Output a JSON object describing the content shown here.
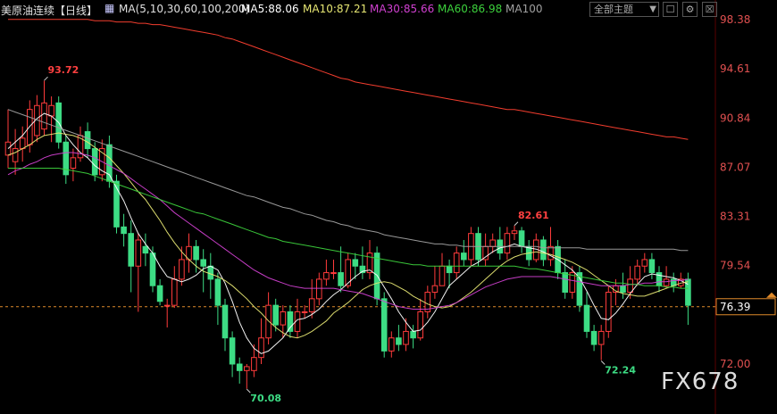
{
  "header": {
    "instrument": "美原油连续【日线】",
    "ma_params": "MA(5,10,30,60,100,200)",
    "ma5": "MA5:88.06",
    "ma10": "MA10:87.21",
    "ma30": "MA30:85.66",
    "ma60": "MA60:86.98",
    "ma100": "MA100"
  },
  "controls": {
    "theme_select": "全部主题",
    "theme_arrow": "▼",
    "btn_window": "☐",
    "btn_settings": "⚙",
    "btn_close": "☒"
  },
  "watermark": "FX678",
  "colors": {
    "up": "#ff3b3b",
    "down": "#3ddc84",
    "ma5": "#ffffff",
    "ma10": "#e6e673",
    "ma30": "#d040d0",
    "ma60": "#3cd03c",
    "ma100": "#a0a0a0",
    "ma200": "#ff4030"
  },
  "chart_data": {
    "type": "candlestick",
    "ylim": [
      72.0,
      98.38
    ],
    "y_ticks": [
      "98.38",
      "94.61",
      "90.84",
      "87.07",
      "83.31",
      "79.54",
      "76.39",
      "72.00"
    ],
    "last_price": 76.39,
    "annotations": [
      {
        "label": "93.72",
        "value": 93.72,
        "index": 5
      },
      {
        "label": "82.61",
        "value": 82.61,
        "index": 70
      },
      {
        "label": "70.08",
        "value": 70.08,
        "index": 33
      },
      {
        "label": "72.24",
        "value": 72.24,
        "index": 82
      }
    ],
    "candles": [
      [
        88.0,
        89.0,
        91.5,
        87.0
      ],
      [
        87.5,
        88.5,
        90.0,
        86.5
      ],
      [
        88.5,
        89.3,
        90.2,
        87.5
      ],
      [
        88.8,
        91.5,
        92.2,
        88.2
      ],
      [
        89.5,
        91.8,
        92.6,
        89.0
      ],
      [
        90.0,
        92.0,
        93.7,
        89.5
      ],
      [
        91.0,
        91.8,
        92.5,
        89.0
      ],
      [
        92.0,
        89.0,
        92.5,
        88.5
      ],
      [
        89.0,
        86.5,
        89.5,
        85.8
      ],
      [
        87.0,
        87.8,
        88.5,
        86.0
      ],
      [
        87.8,
        89.5,
        90.2,
        87.5
      ],
      [
        89.8,
        88.5,
        90.5,
        87.8
      ],
      [
        88.5,
        86.5,
        89.0,
        86.0
      ],
      [
        86.5,
        88.5,
        89.2,
        86.0
      ],
      [
        88.8,
        86.0,
        89.5,
        85.5
      ],
      [
        86.0,
        82.5,
        86.5,
        82.0
      ],
      [
        82.5,
        82.0,
        83.5,
        81.0
      ],
      [
        82.0,
        79.5,
        83.0,
        77.5
      ],
      [
        79.5,
        81.5,
        82.0,
        76.0
      ],
      [
        81.0,
        80.5,
        82.0,
        79.5
      ],
      [
        80.5,
        78.0,
        81.0,
        77.5
      ],
      [
        78.0,
        76.8,
        78.5,
        76.5
      ],
      [
        76.5,
        76.5,
        77.0,
        74.8
      ],
      [
        76.5,
        78.5,
        79.5,
        76.3
      ],
      [
        78.5,
        80.0,
        81.0,
        78.0
      ],
      [
        80.0,
        81.0,
        82.0,
        79.0
      ],
      [
        81.0,
        80.0,
        81.5,
        79.0
      ],
      [
        80.0,
        79.5,
        80.8,
        77.5
      ],
      [
        79.5,
        78.5,
        80.5,
        77.0
      ],
      [
        78.5,
        76.5,
        79.0,
        75.0
      ],
      [
        76.5,
        74.0,
        77.0,
        73.0
      ],
      [
        74.0,
        72.0,
        74.5,
        71.0
      ],
      [
        72.0,
        71.5,
        72.5,
        70.5
      ],
      [
        71.5,
        71.8,
        72.0,
        70.1
      ],
      [
        71.5,
        72.5,
        73.5,
        71.0
      ],
      [
        72.5,
        74.0,
        75.5,
        72.0
      ],
      [
        74.0,
        76.5,
        77.5,
        73.5
      ],
      [
        76.5,
        75.0,
        77.0,
        74.5
      ],
      [
        75.0,
        76.0,
        76.5,
        74.0
      ],
      [
        76.0,
        74.5,
        76.5,
        74.0
      ],
      [
        74.5,
        76.0,
        77.0,
        74.0
      ],
      [
        76.0,
        76.0,
        76.5,
        75.5
      ],
      [
        76.0,
        77.0,
        78.5,
        75.5
      ],
      [
        77.0,
        78.5,
        79.0,
        76.5
      ],
      [
        78.5,
        79.0,
        80.0,
        78.0
      ],
      [
        79.0,
        79.0,
        80.0,
        78.5
      ],
      [
        79.0,
        78.0,
        81.0,
        77.5
      ],
      [
        78.0,
        80.0,
        80.5,
        77.8
      ],
      [
        80.0,
        79.5,
        80.5,
        78.5
      ],
      [
        79.5,
        79.0,
        81.0,
        78.5
      ],
      [
        79.0,
        80.5,
        81.5,
        78.5
      ],
      [
        80.5,
        77.0,
        81.0,
        76.5
      ],
      [
        77.0,
        73.0,
        77.5,
        72.5
      ],
      [
        73.0,
        74.0,
        74.5,
        72.5
      ],
      [
        74.0,
        73.5,
        75.0,
        73.0
      ],
      [
        73.5,
        74.5,
        75.5,
        73.0
      ],
      [
        74.5,
        74.0,
        75.0,
        73.2
      ],
      [
        74.0,
        76.0,
        77.0,
        73.8
      ],
      [
        76.0,
        77.5,
        78.0,
        75.5
      ],
      [
        77.5,
        78.0,
        79.5,
        77.0
      ],
      [
        78.0,
        79.5,
        80.5,
        78.0
      ],
      [
        79.5,
        79.0,
        80.0,
        77.8
      ],
      [
        79.0,
        80.5,
        81.0,
        78.5
      ],
      [
        80.5,
        80.0,
        81.5,
        79.5
      ],
      [
        80.0,
        82.0,
        82.5,
        79.5
      ],
      [
        82.0,
        80.0,
        82.5,
        79.5
      ],
      [
        80.0,
        81.0,
        82.0,
        79.5
      ],
      [
        81.0,
        81.5,
        82.0,
        80.5
      ],
      [
        81.5,
        80.5,
        82.5,
        80.0
      ],
      [
        80.5,
        82.0,
        82.5,
        80.0
      ],
      [
        82.0,
        82.2,
        82.6,
        81.5
      ],
      [
        82.2,
        81.0,
        82.5,
        80.5
      ],
      [
        81.0,
        80.0,
        81.5,
        79.5
      ],
      [
        80.0,
        81.5,
        82.0,
        79.8
      ],
      [
        81.5,
        80.0,
        81.8,
        79.5
      ],
      [
        80.0,
        81.0,
        82.5,
        79.5
      ],
      [
        81.0,
        79.0,
        81.5,
        78.5
      ],
      [
        79.0,
        77.5,
        80.0,
        77.0
      ],
      [
        77.5,
        79.0,
        79.5,
        77.0
      ],
      [
        79.0,
        76.5,
        79.5,
        76.0
      ],
      [
        76.5,
        74.5,
        77.5,
        74.0
      ],
      [
        74.5,
        73.5,
        75.0,
        73.0
      ],
      [
        73.5,
        74.5,
        75.0,
        72.3
      ],
      [
        74.5,
        77.5,
        78.0,
        74.0
      ],
      [
        77.5,
        78.0,
        78.5,
        76.5
      ],
      [
        78.0,
        77.5,
        79.0,
        77.0
      ],
      [
        77.5,
        78.5,
        79.5,
        77.0
      ],
      [
        78.5,
        79.5,
        80.0,
        78.0
      ],
      [
        79.5,
        80.0,
        80.5,
        79.0
      ],
      [
        80.0,
        79.0,
        80.5,
        78.5
      ],
      [
        79.0,
        78.0,
        79.5,
        77.5
      ],
      [
        78.0,
        78.5,
        79.5,
        77.8
      ],
      [
        78.5,
        78.0,
        79.0,
        77.5
      ],
      [
        78.0,
        78.5,
        79.0,
        77.8
      ],
      [
        78.5,
        76.5,
        79.0,
        75.0
      ]
    ],
    "series": [
      {
        "name": "MA5",
        "values": [
          88.5,
          89.0,
          89.5,
          90.2,
          90.8,
          91.2,
          91.0,
          90.5,
          89.5,
          88.8,
          88.2,
          87.8,
          87.2,
          86.8,
          86.5,
          85.5,
          84.5,
          83.2,
          82.0,
          81.2,
          80.5,
          79.5,
          78.7,
          78.5,
          78.3,
          78.5,
          78.8,
          79.3,
          79.5,
          79.2,
          78.2,
          76.8,
          75.2,
          74.0,
          73.2,
          72.8,
          73.0,
          73.5,
          74.0,
          74.8,
          75.4,
          75.5,
          75.8,
          76.2,
          76.8,
          77.3,
          77.7,
          78.2,
          78.7,
          79.1,
          79.2,
          78.8,
          77.9,
          77.0,
          76.0,
          75.2,
          74.5,
          74.6,
          75.2,
          76.0,
          77.0,
          78.0,
          78.5,
          79.0,
          79.5,
          79.8,
          80.2,
          80.6,
          80.9,
          81.0,
          81.2,
          81.0,
          80.9,
          80.8,
          80.6,
          80.3,
          80.0,
          79.6,
          79.2,
          78.6,
          77.6,
          76.5,
          75.5,
          75.4,
          75.9,
          76.6,
          77.4,
          78.1,
          78.7,
          78.9,
          78.8,
          78.7,
          78.6,
          78.4,
          78.1
        ]
      },
      {
        "name": "MA10",
        "values": [
          88.0,
          88.2,
          88.5,
          88.8,
          89.2,
          89.5,
          89.6,
          89.7,
          89.6,
          89.5,
          89.3,
          89.0,
          88.6,
          88.2,
          87.8,
          87.2,
          86.6,
          85.9,
          85.2,
          84.6,
          83.8,
          83.0,
          82.1,
          81.3,
          80.6,
          80.0,
          79.5,
          79.1,
          78.9,
          78.7,
          78.4,
          78.0,
          77.5,
          77.0,
          76.4,
          75.9,
          75.3,
          74.8,
          74.4,
          74.1,
          74.0,
          74.2,
          74.5,
          74.9,
          75.3,
          75.9,
          76.3,
          76.7,
          77.2,
          77.7,
          78.0,
          78.2,
          78.3,
          78.2,
          77.9,
          77.6,
          77.2,
          76.9,
          76.6,
          76.4,
          76.3,
          76.4,
          76.7,
          77.1,
          77.5,
          78.0,
          78.5,
          79.0,
          79.5,
          79.9,
          80.2,
          80.4,
          80.5,
          80.6,
          80.5,
          80.4,
          80.2,
          80.0,
          79.8,
          79.5,
          79.2,
          78.8,
          78.4,
          78.0,
          77.6,
          77.4,
          77.3,
          77.2,
          77.2,
          77.4,
          77.6,
          77.8,
          78.0,
          78.2,
          78.3
        ]
      },
      {
        "name": "MA30",
        "values": [
          86.5,
          86.8,
          87.0,
          87.3,
          87.5,
          87.8,
          88.0,
          88.1,
          88.2,
          88.2,
          88.1,
          88.0,
          87.8,
          87.5,
          87.2,
          86.9,
          86.6,
          86.2,
          85.8,
          85.4,
          85.0,
          84.6,
          84.1,
          83.6,
          83.2,
          82.8,
          82.4,
          82.0,
          81.6,
          81.2,
          80.8,
          80.4,
          80.0,
          79.6,
          79.2,
          78.9,
          78.6,
          78.4,
          78.2,
          78.0,
          77.9,
          77.8,
          77.8,
          77.8,
          77.8,
          77.8,
          77.7,
          77.6,
          77.5,
          77.4,
          77.2,
          77.0,
          76.8,
          76.6,
          76.4,
          76.3,
          76.2,
          76.2,
          76.2,
          76.3,
          76.4,
          76.5,
          76.7,
          77.0,
          77.3,
          77.6,
          77.9,
          78.1,
          78.3,
          78.5,
          78.6,
          78.7,
          78.7,
          78.7,
          78.7,
          78.7,
          78.6,
          78.5,
          78.4,
          78.3,
          78.2,
          78.1,
          78.0,
          78.0,
          78.0,
          78.0,
          78.1,
          78.1,
          78.2,
          78.2,
          78.3,
          78.3,
          78.4,
          78.4,
          78.5
        ]
      },
      {
        "name": "MA60",
        "values": [
          87.0,
          87.0,
          87.0,
          87.0,
          87.0,
          87.0,
          87.0,
          87.0,
          86.9,
          86.8,
          86.7,
          86.6,
          86.4,
          86.2,
          86.0,
          85.8,
          85.6,
          85.4,
          85.2,
          85.0,
          84.8,
          84.6,
          84.4,
          84.2,
          84.0,
          83.8,
          83.6,
          83.5,
          83.3,
          83.1,
          82.9,
          82.7,
          82.5,
          82.3,
          82.1,
          81.9,
          81.7,
          81.6,
          81.4,
          81.3,
          81.2,
          81.1,
          81.0,
          80.9,
          80.8,
          80.7,
          80.6,
          80.5,
          80.4,
          80.3,
          80.2,
          80.1,
          80.0,
          79.9,
          79.8,
          79.7,
          79.6,
          79.6,
          79.5,
          79.5,
          79.5,
          79.5,
          79.5,
          79.5,
          79.5,
          79.5,
          79.5,
          79.5,
          79.5,
          79.5,
          79.5,
          79.4,
          79.3,
          79.3,
          79.2,
          79.1,
          79.0,
          78.9,
          78.8,
          78.7,
          78.6,
          78.5,
          78.4,
          78.3,
          78.2,
          78.2,
          78.1,
          78.1,
          78.0,
          78.0,
          78.0,
          77.9,
          77.9,
          77.8,
          77.8
        ]
      },
      {
        "name": "MA100",
        "values": [
          91.5,
          91.3,
          91.1,
          90.9,
          90.7,
          90.5,
          90.3,
          90.1,
          89.9,
          89.7,
          89.5,
          89.3,
          89.1,
          88.9,
          88.7,
          88.5,
          88.3,
          88.1,
          87.9,
          87.7,
          87.5,
          87.3,
          87.1,
          86.9,
          86.7,
          86.5,
          86.3,
          86.1,
          85.9,
          85.7,
          85.5,
          85.3,
          85.1,
          84.9,
          84.8,
          84.6,
          84.4,
          84.2,
          84.0,
          83.9,
          83.7,
          83.5,
          83.4,
          83.2,
          83.0,
          82.9,
          82.7,
          82.6,
          82.4,
          82.3,
          82.2,
          82.1,
          81.9,
          81.8,
          81.7,
          81.6,
          81.5,
          81.4,
          81.3,
          81.2,
          81.2,
          81.1,
          81.1,
          81.0,
          81.0,
          81.0,
          81.0,
          81.0,
          81.0,
          81.0,
          81.0,
          81.0,
          81.0,
          81.0,
          80.9,
          80.9,
          80.9,
          80.9,
          80.9,
          80.9,
          80.8,
          80.8,
          80.8,
          80.8,
          80.8,
          80.8,
          80.8,
          80.8,
          80.8,
          80.8,
          80.8,
          80.8,
          80.8,
          80.7,
          80.7
        ]
      },
      {
        "name": "MA200",
        "values": [
          98.4,
          98.4,
          98.4,
          98.4,
          98.4,
          98.4,
          98.4,
          98.4,
          98.4,
          98.4,
          98.4,
          98.4,
          98.3,
          98.3,
          98.3,
          98.2,
          98.2,
          98.2,
          98.1,
          98.1,
          98.0,
          98.0,
          97.9,
          97.8,
          97.7,
          97.6,
          97.5,
          97.4,
          97.3,
          97.2,
          97.0,
          96.9,
          96.7,
          96.5,
          96.3,
          96.1,
          95.9,
          95.7,
          95.5,
          95.3,
          95.1,
          94.9,
          94.7,
          94.5,
          94.3,
          94.1,
          93.9,
          93.8,
          93.6,
          93.5,
          93.4,
          93.3,
          93.2,
          93.1,
          93.0,
          92.9,
          92.8,
          92.7,
          92.6,
          92.5,
          92.4,
          92.3,
          92.2,
          92.1,
          92.0,
          91.9,
          91.8,
          91.7,
          91.6,
          91.5,
          91.5,
          91.4,
          91.3,
          91.2,
          91.1,
          91.0,
          90.9,
          90.8,
          90.7,
          90.6,
          90.5,
          90.4,
          90.3,
          90.2,
          90.1,
          90.0,
          89.9,
          89.8,
          89.7,
          89.6,
          89.5,
          89.4,
          89.4,
          89.3,
          89.2
        ]
      }
    ]
  }
}
